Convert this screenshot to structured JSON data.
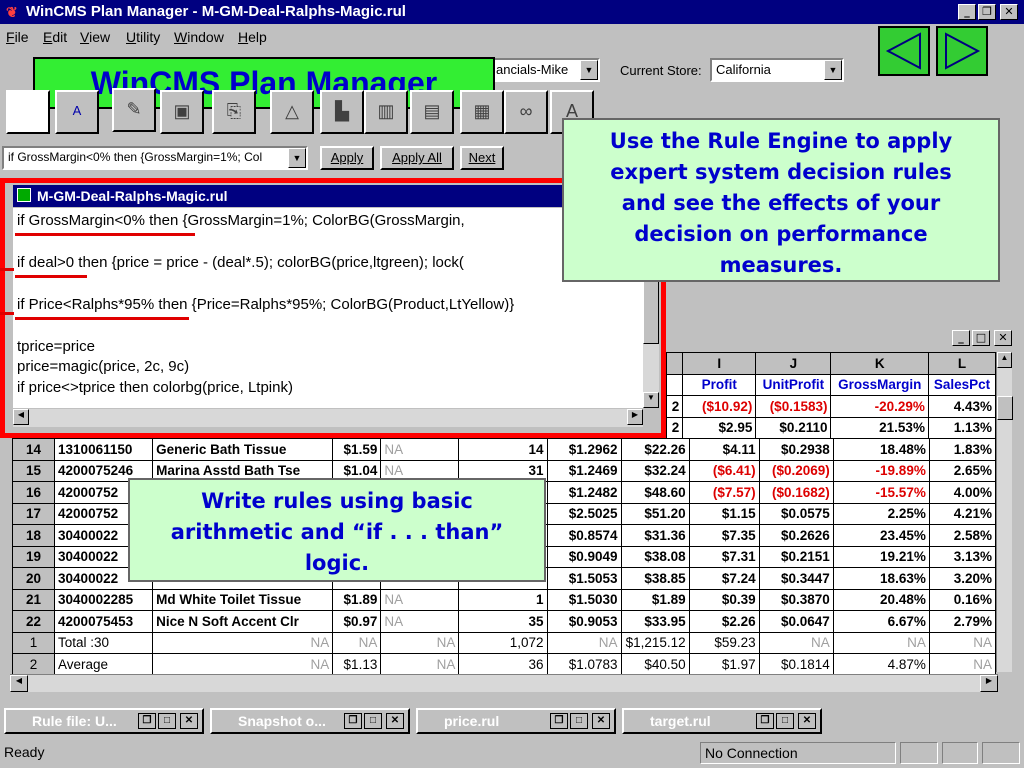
{
  "app": {
    "title": "WinCMS Plan Manager - M-GM-Deal-Ralphs-Magic.rul",
    "banner": "WinCMS Plan Manager"
  },
  "menu": [
    "File",
    "Edit",
    "View",
    "Utility",
    "Window",
    "Help"
  ],
  "toolbar": {
    "combo1_value": "ancials-Mike",
    "store_label": "Current Store:",
    "store_value": "California",
    "rule_combo_value": "if GrossMargin<0% then {GrossMargin=1%; Col",
    "apply_label": "Apply",
    "apply_all_label": "Apply All",
    "next_label": "Next"
  },
  "rule_window": {
    "title": "M-GM-Deal-Ralphs-Magic.rul",
    "lines": [
      "if GrossMargin<0% then {GrossMargin=1%; ColorBG(GrossMargin,",
      "if deal>0 then {price = price - (deal*.5); colorBG(price,ltgreen); lock(",
      "if Price<Ralphs*95% then {Price=Ralphs*95%; ColorBG(Product,LtYellow)}",
      "tprice=price",
      "price=magic(price, 2c, 9c)",
      "if price<>tprice then colorbg(price, Ltpink)"
    ]
  },
  "callouts": {
    "rule_engine": "Use the Rule Engine to apply expert system decision rules and see the effects of your decision on performance measures.",
    "write_rules": "Write rules using basic arithmetic and “if . . . than” logic."
  },
  "sheet": {
    "col_letters": [
      "I",
      "J",
      "K",
      "L"
    ],
    "col_names": [
      "Profit",
      "UnitProfit",
      "GrossMargin",
      "SalesPct"
    ],
    "top_partial": [
      {
        "h": "2",
        "i": "($10.92)",
        "j": "($0.1583)",
        "k": "-20.29%",
        "l": "4.43%"
      },
      {
        "h": "2",
        "i": "$2.95",
        "j": "$0.2110",
        "k": "21.53%",
        "l": "1.13%"
      }
    ],
    "rows": [
      {
        "n": "14",
        "code": "1310061150",
        "desc": "Generic Bath Tissue",
        "price": "$1.59",
        "na": "NA",
        "qty": "14",
        "unit": "$1.2962",
        "sales": "$22.26",
        "profit": "$4.11",
        "uprofit": "$0.2938",
        "gm": "18.48%",
        "pct": "1.83%"
      },
      {
        "n": "15",
        "code": "4200075246",
        "desc": "Marina Asstd Bath Tse",
        "price": "$1.04",
        "na": "NA",
        "qty": "31",
        "unit": "$1.2469",
        "sales": "$32.24",
        "profit": "($6.41)",
        "uprofit": "($0.2069)",
        "gm": "-19.89%",
        "pct": "2.65%"
      },
      {
        "n": "16",
        "code": "42000752",
        "desc": "",
        "price": "",
        "na": "",
        "qty": "",
        "unit": "$1.2482",
        "sales": "$48.60",
        "profit": "($7.57)",
        "uprofit": "($0.1682)",
        "gm": "-15.57%",
        "pct": "4.00%"
      },
      {
        "n": "17",
        "code": "42000752",
        "desc": "",
        "price": "",
        "na": "",
        "qty": "",
        "unit": "$2.5025",
        "sales": "$51.20",
        "profit": "$1.15",
        "uprofit": "$0.0575",
        "gm": "2.25%",
        "pct": "4.21%"
      },
      {
        "n": "18",
        "code": "30400022",
        "desc": "",
        "price": "",
        "na": "",
        "qty": "",
        "unit": "$0.8574",
        "sales": "$31.36",
        "profit": "$7.35",
        "uprofit": "$0.2626",
        "gm": "23.45%",
        "pct": "2.58%"
      },
      {
        "n": "19",
        "code": "30400022",
        "desc": "",
        "price": "",
        "na": "",
        "qty": "",
        "unit": "$0.9049",
        "sales": "$38.08",
        "profit": "$7.31",
        "uprofit": "$0.2151",
        "gm": "19.21%",
        "pct": "3.13%"
      },
      {
        "n": "20",
        "code": "30400022",
        "desc": "",
        "price": "",
        "na": "",
        "qty": "",
        "unit": "$1.5053",
        "sales": "$38.85",
        "profit": "$7.24",
        "uprofit": "$0.3447",
        "gm": "18.63%",
        "pct": "3.20%"
      },
      {
        "n": "21",
        "code": "3040002285",
        "desc": "Md White Toilet Tissue",
        "price": "$1.89",
        "na": "NA",
        "qty": "1",
        "unit": "$1.5030",
        "sales": "$1.89",
        "profit": "$0.39",
        "uprofit": "$0.3870",
        "gm": "20.48%",
        "pct": "0.16%"
      },
      {
        "n": "22",
        "code": "4200075453",
        "desc": "Nice N Soft Accent Clr",
        "price": "$0.97",
        "na": "NA",
        "qty": "35",
        "unit": "$0.9053",
        "sales": "$33.95",
        "profit": "$2.26",
        "uprofit": "$0.0647",
        "gm": "6.67%",
        "pct": "2.79%"
      }
    ],
    "totals": [
      {
        "n": "1",
        "label": "Total :30",
        "c3": "NA",
        "price": "NA",
        "na": "NA",
        "qty": "1,072",
        "unit": "NA",
        "sales": "$1,215.12",
        "profit": "$59.23",
        "uprofit": "NA",
        "gm": "NA",
        "pct": "NA"
      },
      {
        "n": "2",
        "label": "Average",
        "c3": "NA",
        "price": "$1.13",
        "na": "NA",
        "qty": "36",
        "unit": "$1.0783",
        "sales": "$40.50",
        "profit": "$1.97",
        "uprofit": "$0.1814",
        "gm": "4.87%",
        "pct": "NA"
      }
    ]
  },
  "taskbar": [
    "Rule file: U...",
    "Snapshot o...",
    "price.rul",
    "target.rul"
  ],
  "status": {
    "ready": "Ready",
    "connection": "No Connection"
  },
  "colors": {
    "title_bar": "#000080",
    "banner_bg": "#33ee33",
    "callout_bg": "#ccffcc",
    "highlight_red": "#ff0000"
  }
}
